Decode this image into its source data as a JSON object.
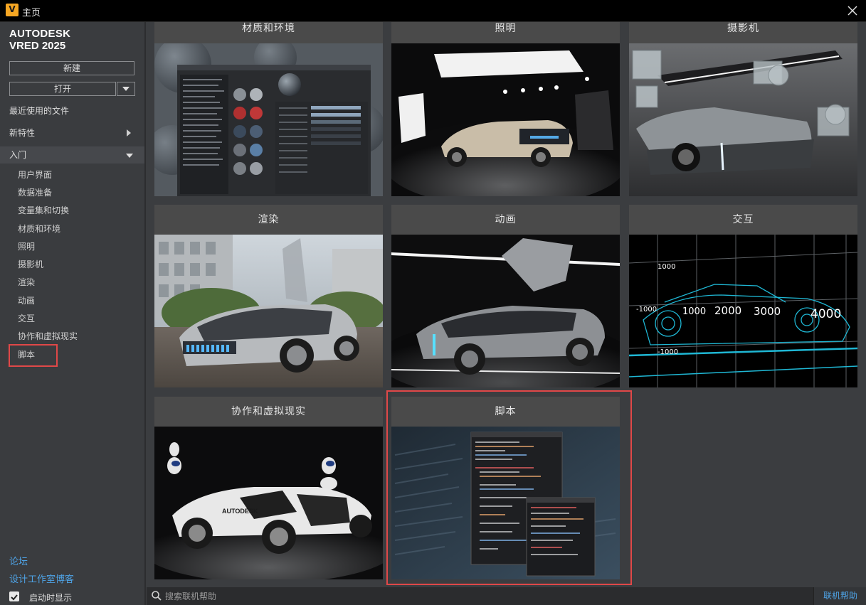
{
  "window": {
    "app_icon_letter": "V",
    "title": "主页",
    "close_icon": "close-icon"
  },
  "brand": {
    "line1": "AUTODESK",
    "line2": "VRED 2025"
  },
  "sidebar": {
    "new_label": "新建",
    "open_label": "打开",
    "recent_label": "最近使用的文件",
    "whats_new_label": "新特性",
    "getting_started_label": "入门",
    "items": [
      {
        "label": "用户界面"
      },
      {
        "label": "数据准备"
      },
      {
        "label": "变量集和切换"
      },
      {
        "label": "材质和环境"
      },
      {
        "label": "照明"
      },
      {
        "label": "摄影机"
      },
      {
        "label": "渲染"
      },
      {
        "label": "动画"
      },
      {
        "label": "交互"
      },
      {
        "label": "协作和虚拟现实"
      },
      {
        "label": "脚本"
      }
    ],
    "forum_label": "论坛",
    "blog_label": "设计工作室博客",
    "startup_label": "启动时显示",
    "startup_checked": true
  },
  "cards": [
    {
      "title": "材质和环境"
    },
    {
      "title": "照明"
    },
    {
      "title": "摄影机"
    },
    {
      "title": "渲染"
    },
    {
      "title": "动画"
    },
    {
      "title": "交互"
    },
    {
      "title": "协作和虚拟现实"
    },
    {
      "title": "脚本"
    }
  ],
  "interaction_img": {
    "labels": [
      "1000",
      "-1000",
      "1000",
      "2000",
      "3000",
      "4000",
      "-1000"
    ]
  },
  "collab_img": {
    "logo_text": "AUTODESK"
  },
  "search": {
    "placeholder": "搜索联机帮助",
    "online_help_label": "联机帮助"
  },
  "colors": {
    "accent_link": "#4ea3e6",
    "highlight": "#e04848",
    "vred_orange": "#f5a623"
  }
}
